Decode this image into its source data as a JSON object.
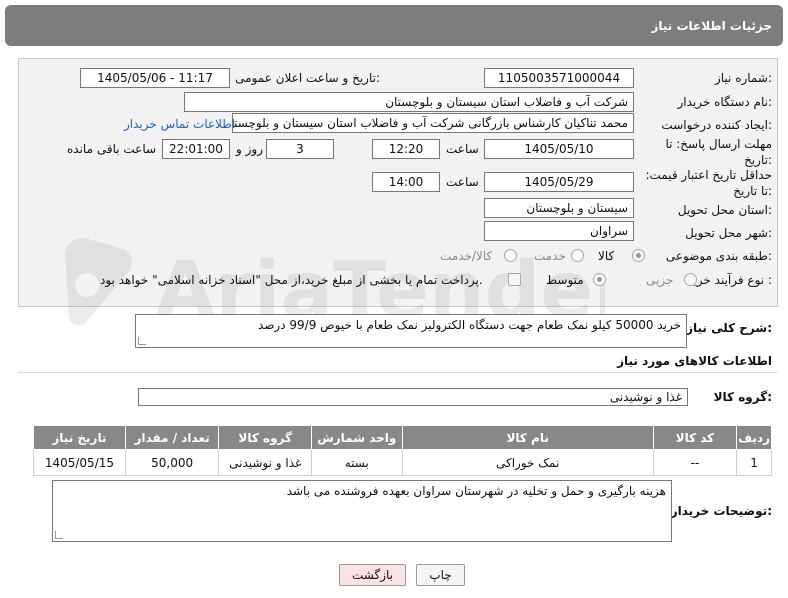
{
  "header": {
    "title": "جزئیات اطلاعات نیاز"
  },
  "labels": {
    "need_number": "شماره نیاز:",
    "announce_datetime": "تاریخ و ساعت اعلان عمومی:",
    "buyer_org": "نام دستگاه خریدار:",
    "requester": "ایجاد کننده درخواست:",
    "deadline": "مهلت ارسال پاسخ: تا تاریخ:",
    "price_validity": "حداقل تاریخ اعتبار قیمت: تا تاریخ:",
    "delivery_province": "استان محل تحویل:",
    "delivery_city": "شهر محل تحویل:",
    "category": "طبقه بندی موضوعی:",
    "process_type": "نوع فرآیند خرید :",
    "time": "ساعت",
    "day_and": "روز و",
    "remaining": "ساعت باقی مانده",
    "general_desc": "شرح کلی نیاز:",
    "goods_info": "اطلاعات کالاهای مورد نیاز",
    "goods_group": "گروه کالا:",
    "buyer_notes": "توضیحات خریدار:"
  },
  "fields": {
    "need_number": "1105003571000044",
    "announce_datetime": "1405/05/06 - 11:17",
    "buyer_org": "شرکت آب و فاضلاب استان سیستان و بلوچستان",
    "requester": "محمد تناکیان کارشناس بازرگانی شرکت آب و فاضلاب استان سیستان و بلوچستان",
    "deadline_date": "1405/05/10",
    "deadline_time": "12:20",
    "deadline_days": "3",
    "deadline_remaining": "22:01:00",
    "price_date": "1405/05/29",
    "price_time": "14:00",
    "delivery_province": "سیستان و بلوچستان",
    "delivery_city": "سراوان",
    "goods_group": "غذا و نوشیدنی"
  },
  "contact_link": "اطلاعات تماس خریدار",
  "category_options": [
    "کالا",
    "خدمت",
    "کالا/خدمت"
  ],
  "process_options": [
    "جزیی",
    "متوسط"
  ],
  "payment_note": "پرداخت تمام یا بخشی از مبلغ خرید،از محل \"اسناد خزانه اسلامی\" خواهد بود.",
  "general_desc_text": "خرید 50000 کیلو نمک طعام جهت دستگاه الکترولیز نمک طعام با خیوص 99/9 درصد",
  "table": {
    "headers": [
      "ردیف",
      "کد کالا",
      "نام کالا",
      "واحد شمارش",
      "گروه کالا",
      "تعداد / مقدار",
      "تاریخ نیاز"
    ],
    "rows": [
      [
        "1",
        "--",
        "نمک خوراکی",
        "بسته",
        "غذا و نوشیدنی",
        "50,000",
        "1405/05/15"
      ]
    ]
  },
  "buyer_notes_text": "هزینه بارگیری و حمل و تخلیه در شهرستان سراوان بعهده فروشنده می باشد",
  "buttons": {
    "print": "چاپ",
    "back": "بازگشت"
  },
  "watermark_text": "AriaTender.neT",
  "colors": {
    "header_bg": "#7d7d7d",
    "table_header_bg": "#888888",
    "link": "#1e63c4",
    "back_button_bg": "#fce3e3"
  }
}
